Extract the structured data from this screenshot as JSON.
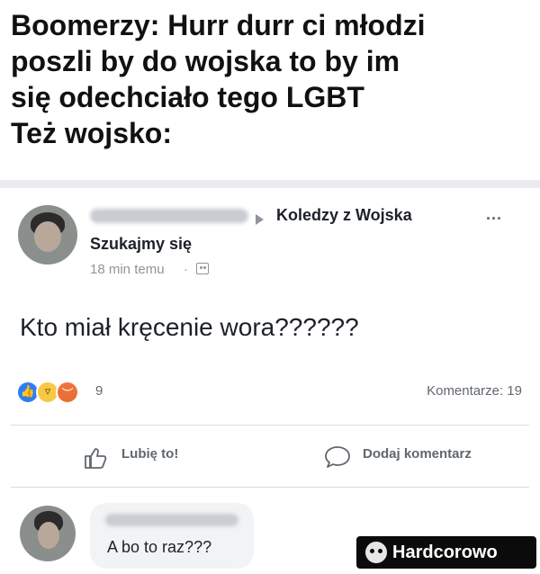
{
  "caption": {
    "line1": "Boomerzy: Hurr durr ci młodzi",
    "line2": "poszli by do wojska to by im",
    "line3": "się odechciało tego LGBT",
    "line4": "Też wojsko:"
  },
  "post": {
    "group_name": "Koledzy z Wojska",
    "more_label": "...",
    "subtitle": "Szukajmy się",
    "time": "18 min temu",
    "time_separator": "·",
    "text": "Kto  miał kręcenie wora??????",
    "reaction_count": "9",
    "comments_label": "Komentarze: 19",
    "like_label": "Lubię to!",
    "comment_label": "Dodaj komentarz"
  },
  "comment": {
    "text": "A bo to raz???"
  },
  "watermark": {
    "text": "Hardcorowo"
  },
  "colors": {
    "facebook_blue": "#2d7df6",
    "text_dark": "#1d2129",
    "text_gray": "#606770",
    "comment_bg": "#f2f3f5"
  }
}
